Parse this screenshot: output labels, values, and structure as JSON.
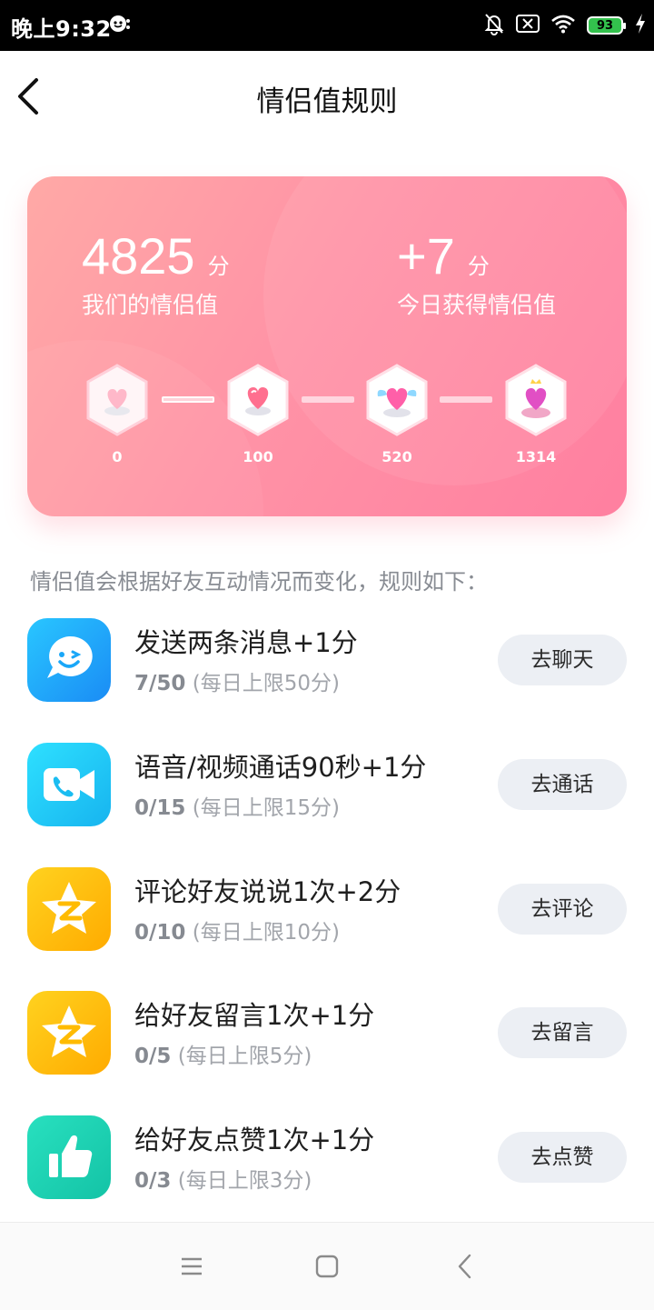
{
  "status_bar": {
    "time": "晚上9:32",
    "battery": "93",
    "icons": [
      "chat-notification-icon",
      "silent-bell-icon",
      "sim-off-icon",
      "wifi-icon",
      "battery-icon",
      "charging-icon"
    ]
  },
  "header": {
    "title": "情侣值规则",
    "back_icon": "chevron-left-icon"
  },
  "summary_card": {
    "total_value": "4825",
    "total_unit": "分",
    "total_label": "我们的情侣值",
    "today_value": "+7",
    "today_unit": "分",
    "today_label": "今日获得情侣值",
    "levels": [
      {
        "label": "0",
        "icon": "heart-badge-icon"
      },
      {
        "label": "100",
        "icon": "heart-badge-icon"
      },
      {
        "label": "520",
        "icon": "winged-heart-badge-icon"
      },
      {
        "label": "1314",
        "icon": "crowned-heart-badge-icon"
      }
    ],
    "gradient_colors": [
      "#ffa9a6",
      "#ff7fa0"
    ]
  },
  "rules": {
    "intro": "情侣值会根据好友互动情况而变化，规则如下：",
    "items": [
      {
        "title": "发送两条消息+1分",
        "count": "7/50",
        "limit": "(每日上限50分)",
        "button": "去聊天",
        "icon": "chat-smile-icon",
        "color": "#1cb0f6"
      },
      {
        "title": "语音/视频通话90秒+1分",
        "count": "0/15",
        "limit": "(每日上限15分)",
        "button": "去通话",
        "icon": "video-call-icon",
        "color": "#1fc7f3"
      },
      {
        "title": "评论好友说说1次+2分",
        "count": "0/10",
        "limit": "(每日上限10分)",
        "button": "去评论",
        "icon": "qzone-star-icon",
        "color": "#ffc400"
      },
      {
        "title": "给好友留言1次+1分",
        "count": "0/5",
        "limit": "(每日上限5分)",
        "button": "去留言",
        "icon": "qzone-star-icon",
        "color": "#ffc400"
      },
      {
        "title": "给好友点赞1次+1分",
        "count": "0/3",
        "limit": "(每日上限3分)",
        "button": "去点赞",
        "icon": "thumbs-up-icon",
        "color": "#1fd3b3"
      }
    ]
  },
  "nav_bar": {
    "icons": [
      "menu-icon",
      "home-square-icon",
      "back-triangle-icon"
    ]
  }
}
